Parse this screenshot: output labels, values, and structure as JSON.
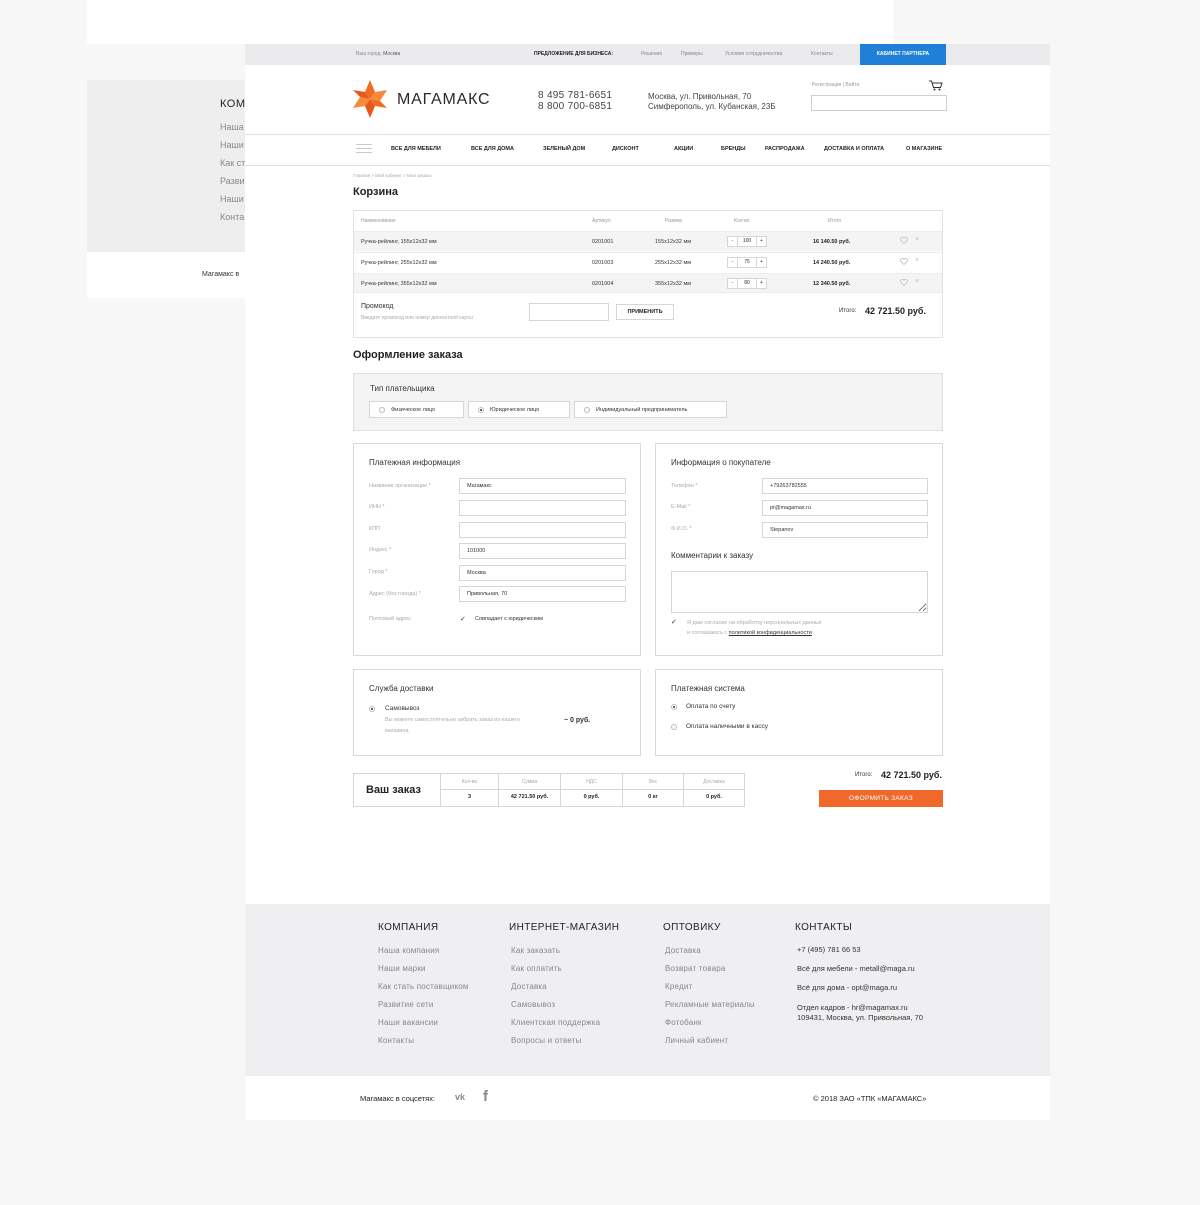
{
  "background_page": {
    "title": "КОМП",
    "links": [
      "Наша",
      "Наши",
      "Как ст",
      "Разви",
      "Наши",
      "Конта"
    ],
    "social": "Магамакс в"
  },
  "topbar": {
    "city_label": "Ваш город:",
    "city": "Москва",
    "business": "ПРЕДЛОЖЕНИЕ ДЛЯ БИЗНЕСА:",
    "links": [
      "Решения",
      "Примеры",
      "Условия сотрудничества",
      "Контакты"
    ],
    "partner_button": "КАБИНЕТ ПАРТНЕРА"
  },
  "header": {
    "logo_text": "МАГАМАКС",
    "phone1": "8 495 781-6651",
    "phone2": "8 800 700-6851",
    "address1": "Москва, ул. Привольная, 70",
    "address2": "Симферополь, ул. Кубанская, 23Б",
    "register": "Регистрация",
    "login": "Войти",
    "search_placeholder": ""
  },
  "nav": [
    "ВСЕ ДЛЯ МЕБЕЛИ",
    "ВСЕ ДЛЯ ДОМА",
    "ЗЕЛЕНЫЙ ДОМ",
    "ДИСКОНТ",
    "АКЦИИ",
    "БРЕНДЫ",
    "РАСПРОДАЖА",
    "ДОСТАВКА И ОПЛАТА",
    "О МАГАЗИНЕ"
  ],
  "breadcrumb": "Главная > Мой кабинет > Мои заказы",
  "cart": {
    "title": "Корзина",
    "headers": [
      "Наименование",
      "Артикул",
      "Размер",
      "Кол-во",
      "Итого"
    ],
    "rows": [
      {
        "name": "Ручка-рейлинг, 155х12х32 мм",
        "sku": "0201001",
        "size": "155х12х32 мм",
        "qty": "100",
        "total": "16 140.50 руб."
      },
      {
        "name": "Ручка-рейлинг, 255х12х32 мм",
        "sku": "0201003",
        "size": "255х12х32 мм",
        "qty": "75",
        "total": "14 240.50 руб."
      },
      {
        "name": "Ручка-рейлинг, 355х12х32 мм",
        "sku": "0201004",
        "size": "355х12х32 мм",
        "qty": "80",
        "total": "12 340.50 руб."
      }
    ],
    "minus": "-",
    "plus": "+",
    "promo_label": "Промокод",
    "promo_hint": "Введите промокод или номер дисконтной карты",
    "apply_button": "ПРИМЕНИТЬ",
    "total_label": "Итого:",
    "total_value": "42 721.50 руб."
  },
  "checkout": {
    "title": "Оформление заказа",
    "payer_label": "Тип плательщика",
    "payer_options": [
      "Физическое лицо",
      "Юридическое лицо",
      "Индивидуальный предприниматель"
    ],
    "payment_info": {
      "title": "Платежная информация",
      "fields": [
        {
          "label": "Название организации *",
          "value": "Магамакс"
        },
        {
          "label": "ИНН *",
          "value": ""
        },
        {
          "label": "КПП",
          "value": ""
        },
        {
          "label": "Индекс *",
          "value": "101000"
        },
        {
          "label": "Город *",
          "value": "Москва"
        },
        {
          "label": "Адрес (без города) *",
          "value": "Привольная, 70"
        }
      ],
      "postal_label": "Почтовый адрес",
      "postal_check": "Совпадает с юридическим"
    },
    "buyer_info": {
      "title": "Информация о покупателе",
      "fields": [
        {
          "label": "Телефон *",
          "value": "+79263782555"
        },
        {
          "label": "E-Mail *",
          "value": "pr@magamax.ru"
        },
        {
          "label": "Ф.И.О. *",
          "value": "Stepanov"
        }
      ],
      "comment_label": "Комментарии к заказу",
      "consent1": "Я даю согласие на обработку персональных данных",
      "consent2": "и соглашаюсь с",
      "consent_link": "политикой конфиденциальности"
    },
    "delivery": {
      "title": "Служба доставки",
      "option": "Самовывоз",
      "desc1": "Вы можете самостоятельно забрать заказ из нашего",
      "desc2": "магазина.",
      "price": "~ 0 руб."
    },
    "payment_system": {
      "title": "Платежная система",
      "options": [
        "Оплата по счету",
        "Оплата наличными в кассу"
      ]
    },
    "summary": {
      "title": "Ваш заказ",
      "cols": [
        {
          "h": "Кол-во",
          "v": "3"
        },
        {
          "h": "Сумма",
          "v": "42 721.50 руб."
        },
        {
          "h": "НДС",
          "v": "0 руб."
        },
        {
          "h": "Вес",
          "v": "0 кг"
        },
        {
          "h": "Доставка",
          "v": "0 руб."
        }
      ],
      "total_label": "Итого:",
      "total_value": "42 721.50 руб.",
      "submit": "ОФОРМИТЬ ЗАКАЗ"
    }
  },
  "footer": {
    "columns": [
      {
        "title": "КОМПАНИЯ",
        "links": [
          "Наша компания",
          "Наши марки",
          "Как стать поставщиком",
          "Развитие сети",
          "Наши вакансии",
          "Контакты"
        ]
      },
      {
        "title": "ИНТЕРНЕТ-МАГАЗИН",
        "links": [
          "Как заказать",
          "Как оплатить",
          "Доставка",
          "Самовывоз",
          "Клиентская поддержка",
          "Вопросы и ответы"
        ]
      },
      {
        "title": "ОПТОВИКУ",
        "links": [
          "Доставка",
          "Возврат товара",
          "Кредит",
          "Рекламные материалы",
          "Фотобанк",
          "Личный кабиент"
        ]
      }
    ],
    "contacts_title": "КОНТАКТЫ",
    "contacts": [
      "+7 (495) 781 66 53",
      "Всё для мебели - metall@maga.ru",
      "Всё для дома - opt@maga.ru",
      "Отдел кадров - hr@magamax.ru",
      "109431, Москва, ул. Привольная, 70"
    ],
    "social_label": "Магамакс в соцсетях:",
    "vk": "vk",
    "fb": "f",
    "copyright": "© 2018 ЗАО «ТПК «МАГАМАКС»"
  },
  "colors": {
    "accent": "#f0692a",
    "partner_blue": "#1e80d6",
    "logo_orange": "#f26b21"
  }
}
